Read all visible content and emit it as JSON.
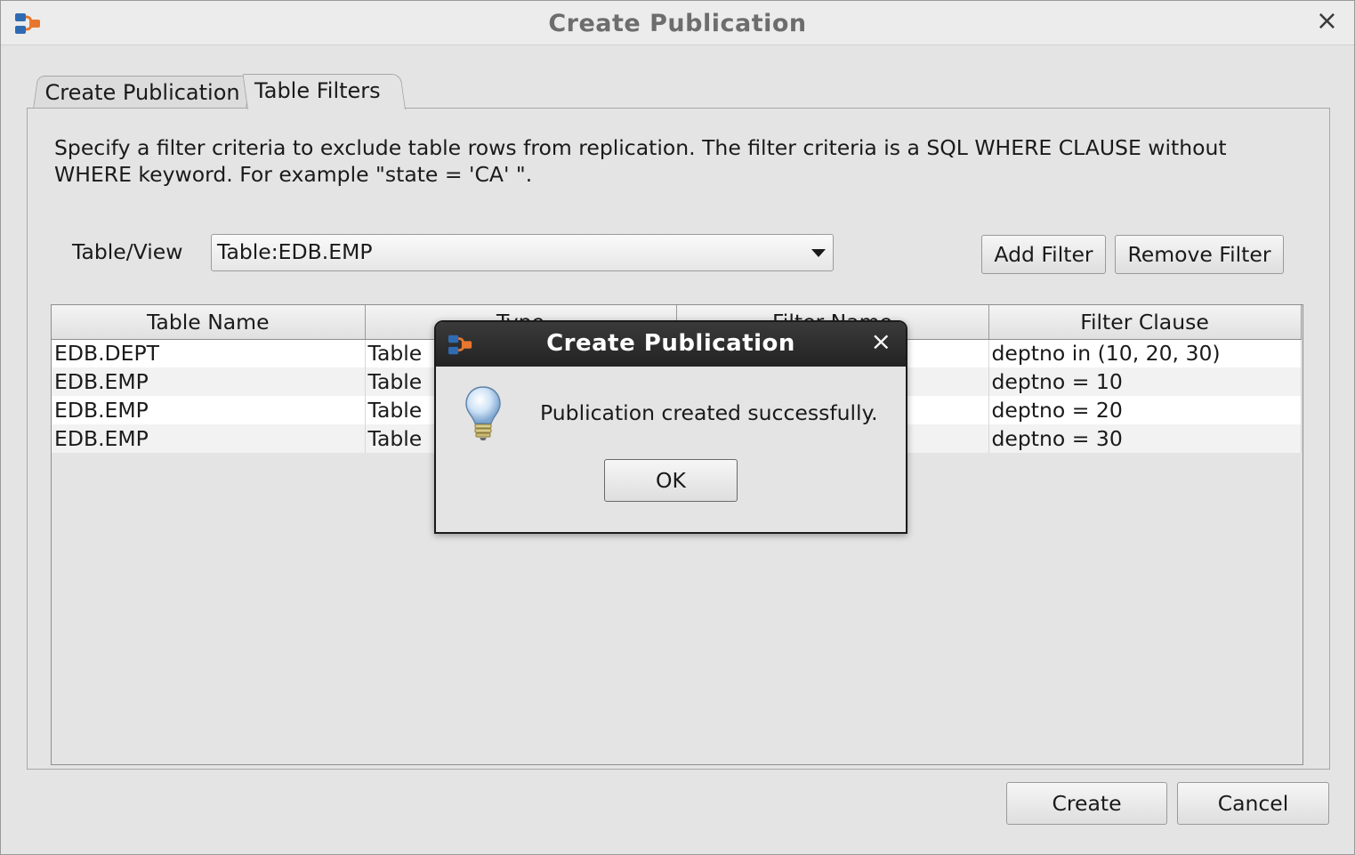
{
  "window": {
    "title": "Create Publication",
    "close_glyph": "×"
  },
  "tabs": [
    {
      "label": "Create Publication",
      "active": false
    },
    {
      "label": "Table Filters",
      "active": true
    }
  ],
  "instructions": "Specify a filter criteria to exclude table rows from replication. The filter criteria is a SQL WHERE CLAUSE without WHERE keyword. For example \"state = 'CA' \".",
  "table_view": {
    "label": "Table/View",
    "selected": "Table:EDB.EMP"
  },
  "buttons": {
    "add_filter": "Add Filter",
    "remove_filter": "Remove Filter",
    "create": "Create",
    "cancel": "Cancel"
  },
  "filters_table": {
    "columns": [
      "Table Name",
      "Type",
      "Filter Name",
      "Filter Clause"
    ],
    "rows": [
      {
        "table_name": "EDB.DEPT",
        "type": "Table",
        "filter_name": "",
        "filter_clause": "deptno in (10, 20, 30)"
      },
      {
        "table_name": "EDB.EMP",
        "type": "Table",
        "filter_name": "",
        "filter_clause": "deptno = 10"
      },
      {
        "table_name": "EDB.EMP",
        "type": "Table",
        "filter_name": "",
        "filter_clause": "deptno = 20"
      },
      {
        "table_name": "EDB.EMP",
        "type": "Table",
        "filter_name": "",
        "filter_clause": "deptno = 30"
      }
    ]
  },
  "dialog": {
    "title": "Create Publication",
    "message": "Publication created successfully.",
    "ok_label": "OK",
    "icon": "lightbulb-icon",
    "close_glyph": "×"
  },
  "colors": {
    "dialog_titlebar": "#2d2d2d",
    "window_bg": "#e4e4e4",
    "app_icon_orange": "#e8772e",
    "app_icon_blue": "#2f6bb3"
  }
}
